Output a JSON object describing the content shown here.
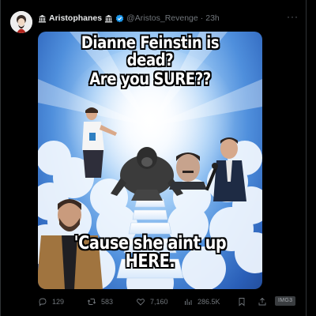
{
  "post": {
    "display_name": "Aristophanes",
    "handle": "@Aristos_Revenge",
    "separator": "·",
    "timestamp": "23h",
    "more_label": "···"
  },
  "media": {
    "caption_line1": "Dianne Feinstin is",
    "caption_line2": "dead?",
    "caption_line3": "Are you SURE??",
    "caption_bottom": "'Cause she aint up HERE."
  },
  "actions": {
    "replies": "129",
    "reposts": "583",
    "likes": "7,160",
    "views": "286.5K",
    "badge": "IMG3"
  },
  "colors": {
    "background": "#000000",
    "text_primary": "#e7e9ea",
    "text_secondary": "#71767b",
    "verified_blue": "#1d9bf0"
  }
}
